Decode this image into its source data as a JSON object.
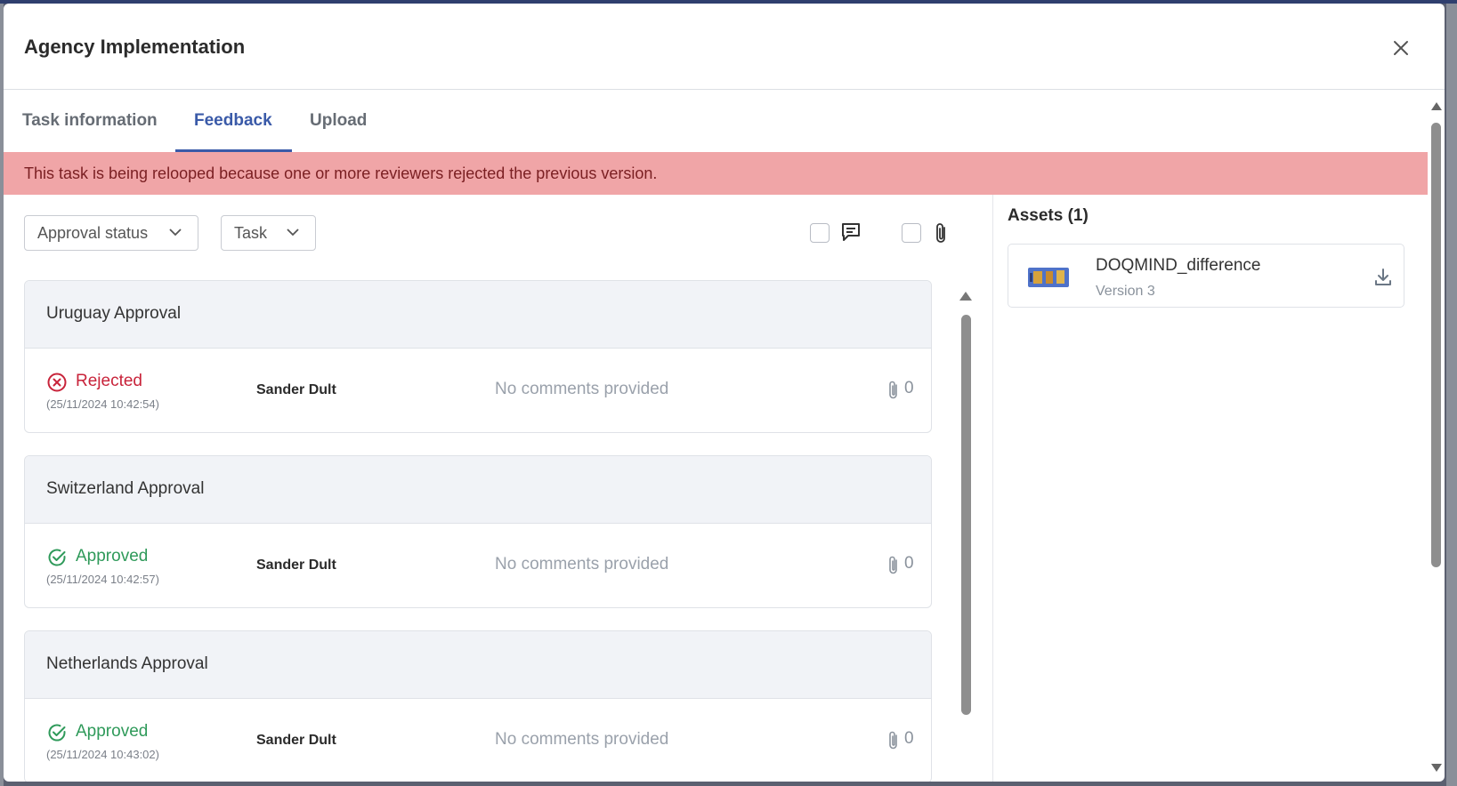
{
  "modal": {
    "title": "Agency Implementation",
    "close_icon": "close-icon"
  },
  "tabs": [
    {
      "label": "Task information",
      "active": false
    },
    {
      "label": "Feedback",
      "active": true
    },
    {
      "label": "Upload",
      "active": false
    }
  ],
  "alert": {
    "message": "This task is being relooped because one or more reviewers rejected the previous version.",
    "background": "#f0a5a7"
  },
  "filters": {
    "approval_status_label": "Approval status",
    "task_label": "Task",
    "comments_icon": "comment-icon",
    "attachments_icon": "paperclip-icon"
  },
  "feedback": [
    {
      "title": "Uruguay Approval",
      "status": "Rejected",
      "status_icon": "x-circle-icon",
      "timestamp": "(25/11/2024 10:42:54)",
      "reviewer": "Sander Dult",
      "comment": "No comments provided",
      "attachments": "0"
    },
    {
      "title": "Switzerland Approval",
      "status": "Approved",
      "status_icon": "check-circle-icon",
      "timestamp": "(25/11/2024 10:42:57)",
      "reviewer": "Sander Dult",
      "comment": "No comments provided",
      "attachments": "0"
    },
    {
      "title": "Netherlands Approval",
      "status": "Approved",
      "status_icon": "check-circle-icon",
      "timestamp": "(25/11/2024 10:43:02)",
      "reviewer": "Sander Dult",
      "comment": "No comments provided",
      "attachments": "0"
    }
  ],
  "assets": {
    "title": "Assets (1)",
    "items": [
      {
        "name": "DOQMIND_difference",
        "version": "Version 3",
        "icon": "download-icon"
      }
    ]
  },
  "colors": {
    "accent": "#3a5aa8",
    "rejected": "#c8233a",
    "approved": "#2f9a5a"
  }
}
